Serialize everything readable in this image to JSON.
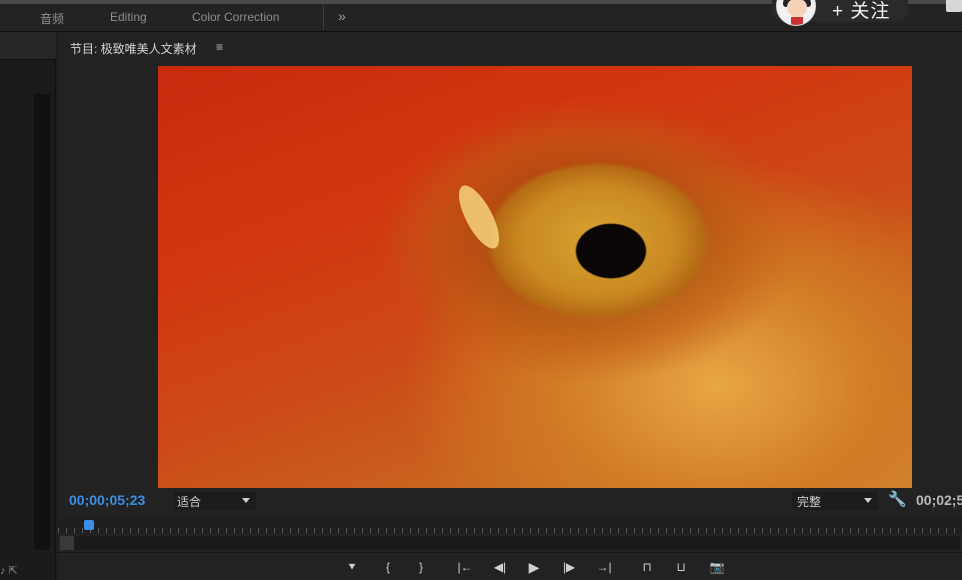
{
  "workspace_tabs": [
    "音频",
    "Editing",
    "Color Correction"
  ],
  "workspace_more": "»",
  "overlay": {
    "follow_label": "+ 关注"
  },
  "monitor": {
    "title": "节目: 极致唯美人文素材",
    "menu_icon": "≡",
    "timecode": "00;00;05;23",
    "fit_select": "适合",
    "quality_select": "完整",
    "duration": "00;02;5",
    "playhead_progress": 0.03
  },
  "controls": [
    {
      "name": "add-marker-button",
      "icon": "marker-icon",
      "glyph": "⯆"
    },
    {
      "name": "mark-in-button",
      "icon": "mark-in-icon",
      "glyph": "{"
    },
    {
      "name": "mark-out-button",
      "icon": "mark-out-icon",
      "glyph": "}"
    },
    {
      "name": "go-to-in-button",
      "icon": "go-to-in-icon",
      "glyph": "|←"
    },
    {
      "name": "step-back-button",
      "icon": "step-back-icon",
      "glyph": "◀|"
    },
    {
      "name": "play-button",
      "icon": "play-icon",
      "glyph": "▶"
    },
    {
      "name": "step-forward-button",
      "icon": "step-forward-icon",
      "glyph": "|▶"
    },
    {
      "name": "go-to-out-button",
      "icon": "go-to-out-icon",
      "glyph": "→|"
    },
    {
      "name": "lift-button",
      "icon": "lift-icon",
      "glyph": "⊓"
    },
    {
      "name": "extract-button",
      "icon": "extract-icon",
      "glyph": "⊔"
    },
    {
      "name": "export-frame-button",
      "icon": "camera-icon",
      "glyph": "📷"
    }
  ],
  "left_panel": {
    "icons": "♪ ⇱"
  }
}
